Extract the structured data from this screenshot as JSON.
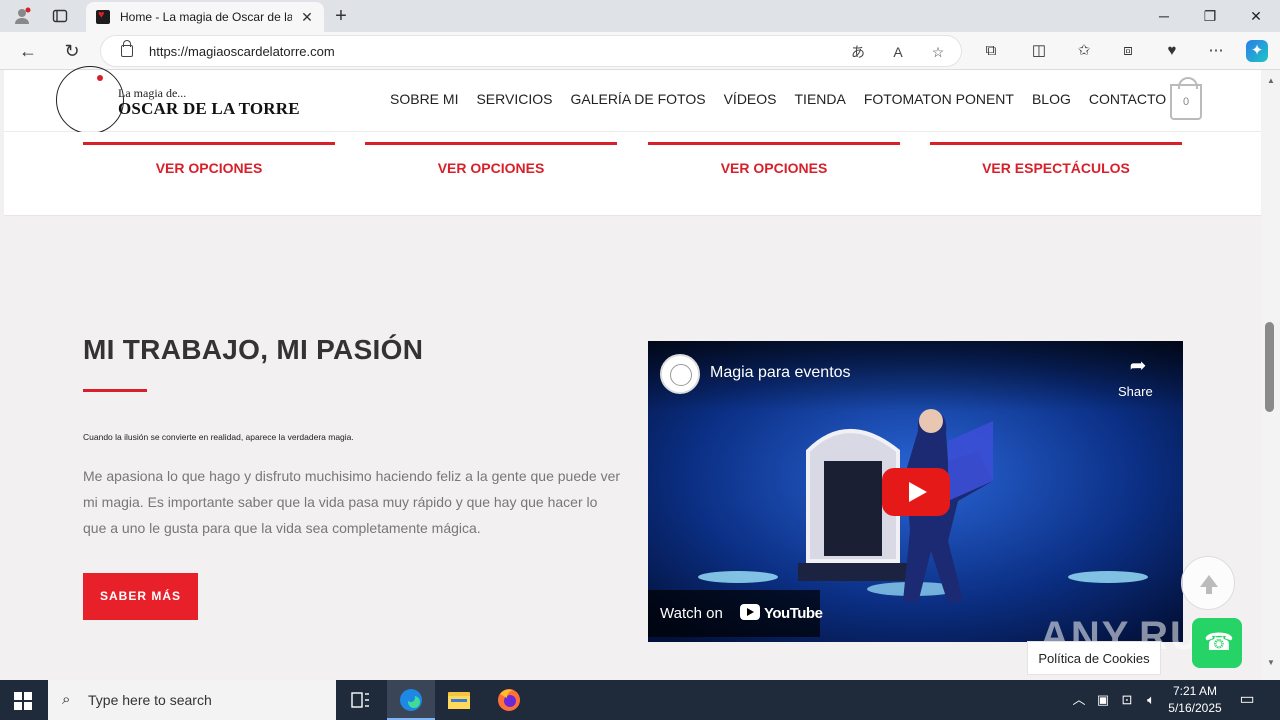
{
  "browser": {
    "tab_title": "Home - La magia de Oscar de la Torre",
    "url": "https://magiaoscardelatorre.com",
    "icons": {
      "profile": "profile-icon",
      "tabs": "tab-actions-icon",
      "back": "back-arrow-icon",
      "refresh": "refresh-icon",
      "lock": "lock-icon",
      "translate": "translate-icon",
      "read_aloud": "read-aloud-icon",
      "favorite": "star-icon",
      "extensions": "puzzle-icon",
      "split": "split-screen-icon",
      "favorites": "favorites-icon",
      "collections": "collections-icon",
      "vpn": "shield-icon",
      "more": "more-icon",
      "copilot": "copilot-icon"
    }
  },
  "site": {
    "logo_small": "La magia de...",
    "logo_big": "OSCAR DE LA TORRE",
    "menu": [
      "SOBRE MI",
      "SERVICIOS",
      "GALERÍA DE FOTOS",
      "VÍDEOS",
      "TIENDA",
      "FOTOMATON PONENT",
      "BLOG",
      "CONTACTO"
    ],
    "cart_count": "0"
  },
  "options": [
    "VER OPCIONES",
    "VER OPCIONES",
    "VER OPCIONES",
    "VER ESPECTÁCULOS"
  ],
  "section": {
    "headline": "MI TRABAJO, MI PASIÓN",
    "tagline": "Cuando la ilusión se convierte en realidad, aparece la verdadera magia.",
    "paragraph": "Me apasiona lo que hago y disfruto muchisimo haciendo feliz a la gente que puede ver mi magia. Es importante saber que la vida pasa muy rápido y que hay que hacer lo que a uno le gusta para que la vida sea completamente mágica.",
    "cta_label": "SABER MÁS"
  },
  "video": {
    "title": "Magia para eventos",
    "share_label": "Share",
    "watch_on": "Watch on",
    "youtube": "YouTube"
  },
  "widgets": {
    "cookie_label": "Política de Cookies",
    "watermark": "ANY.RUN"
  },
  "taskbar": {
    "search_placeholder": "Type here to search",
    "time": "7:21 AM",
    "date": "5/16/2025"
  },
  "colors": {
    "accent": "#d81f2a",
    "cta": "#e8202a",
    "section_bg": "#f3f0f1",
    "taskbar": "#1f2a3a"
  }
}
